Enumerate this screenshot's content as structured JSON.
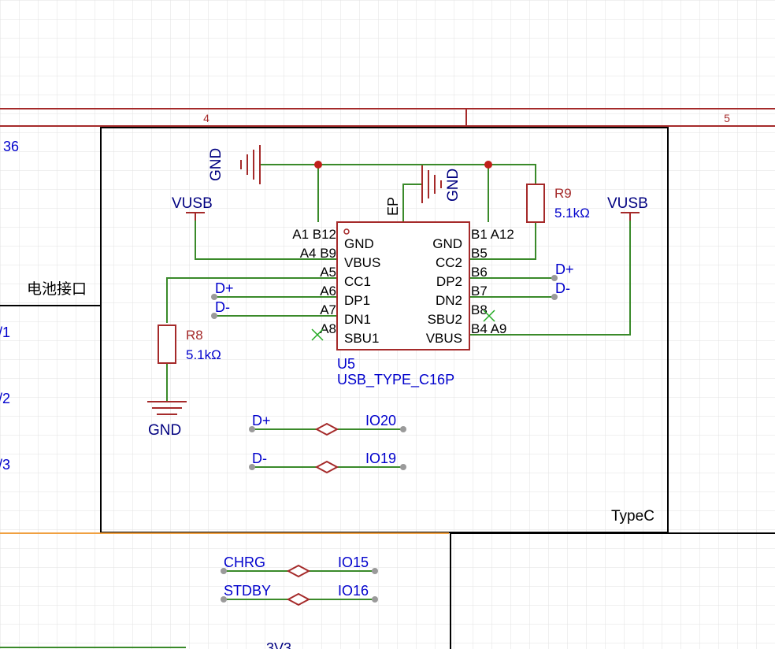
{
  "colors": {
    "background": "#ffffff",
    "grid": "#e2e2e2",
    "frame_border": "#a52a2a",
    "sheet_border": "#000000",
    "wire": "#3a8a2a",
    "component": "#a52a2a",
    "net_label": "#0000cc",
    "pin_text": "#000000",
    "junction": "#c0201a",
    "pin_end": "#9a9a9a",
    "no_connect": "#22aa22",
    "highlight": "#f0a040"
  },
  "frame": {
    "zone_left": "4",
    "zone_right": "5"
  },
  "left_panel": {
    "fragment_top": "36",
    "battery_label": "电池接口",
    "fragments": [
      "/1",
      "/2",
      "/3"
    ]
  },
  "typec_block": {
    "title": "TypeC",
    "gnd_top": "GND",
    "gnd_ep": "GND",
    "ep_label": "EP",
    "vusb_left": "VUSB",
    "vusb_right": "VUSB",
    "gnd_bottom": "GND",
    "r8": {
      "ref": "R8",
      "value": "5.1kΩ"
    },
    "r9": {
      "ref": "R9",
      "value": "5.1kΩ"
    },
    "u5": {
      "ref": "U5",
      "name": "USB_TYPE_C16P",
      "left_pins": [
        {
          "num": "A1 B12",
          "name": "GND"
        },
        {
          "num": "A4 B9",
          "name": "VBUS"
        },
        {
          "num": "A5",
          "name": "CC1"
        },
        {
          "num": "A6",
          "name": "DP1"
        },
        {
          "num": "A7",
          "name": "DN1"
        },
        {
          "num": "A8",
          "name": "SBU1"
        }
      ],
      "right_pins": [
        {
          "num": "B1 A12",
          "name": "GND"
        },
        {
          "num": "B5",
          "name": "CC2"
        },
        {
          "num": "B6",
          "name": "DP2"
        },
        {
          "num": "B7",
          "name": "DN2"
        },
        {
          "num": "B8",
          "name": "SBU2"
        },
        {
          "num": "B4 A9",
          "name": "VBUS"
        }
      ]
    },
    "left_nets": {
      "dp": "D+",
      "dm": "D-"
    },
    "right_nets": {
      "dp": "D+",
      "dm": "D-"
    },
    "links": [
      {
        "from": "D+",
        "to": "IO20"
      },
      {
        "from": "D-",
        "to": "IO19"
      }
    ]
  },
  "bottom_panel": {
    "links": [
      {
        "from": "CHRG",
        "to": "IO15"
      },
      {
        "from": "STDBY",
        "to": "IO16"
      }
    ],
    "fragment": "3V3"
  }
}
